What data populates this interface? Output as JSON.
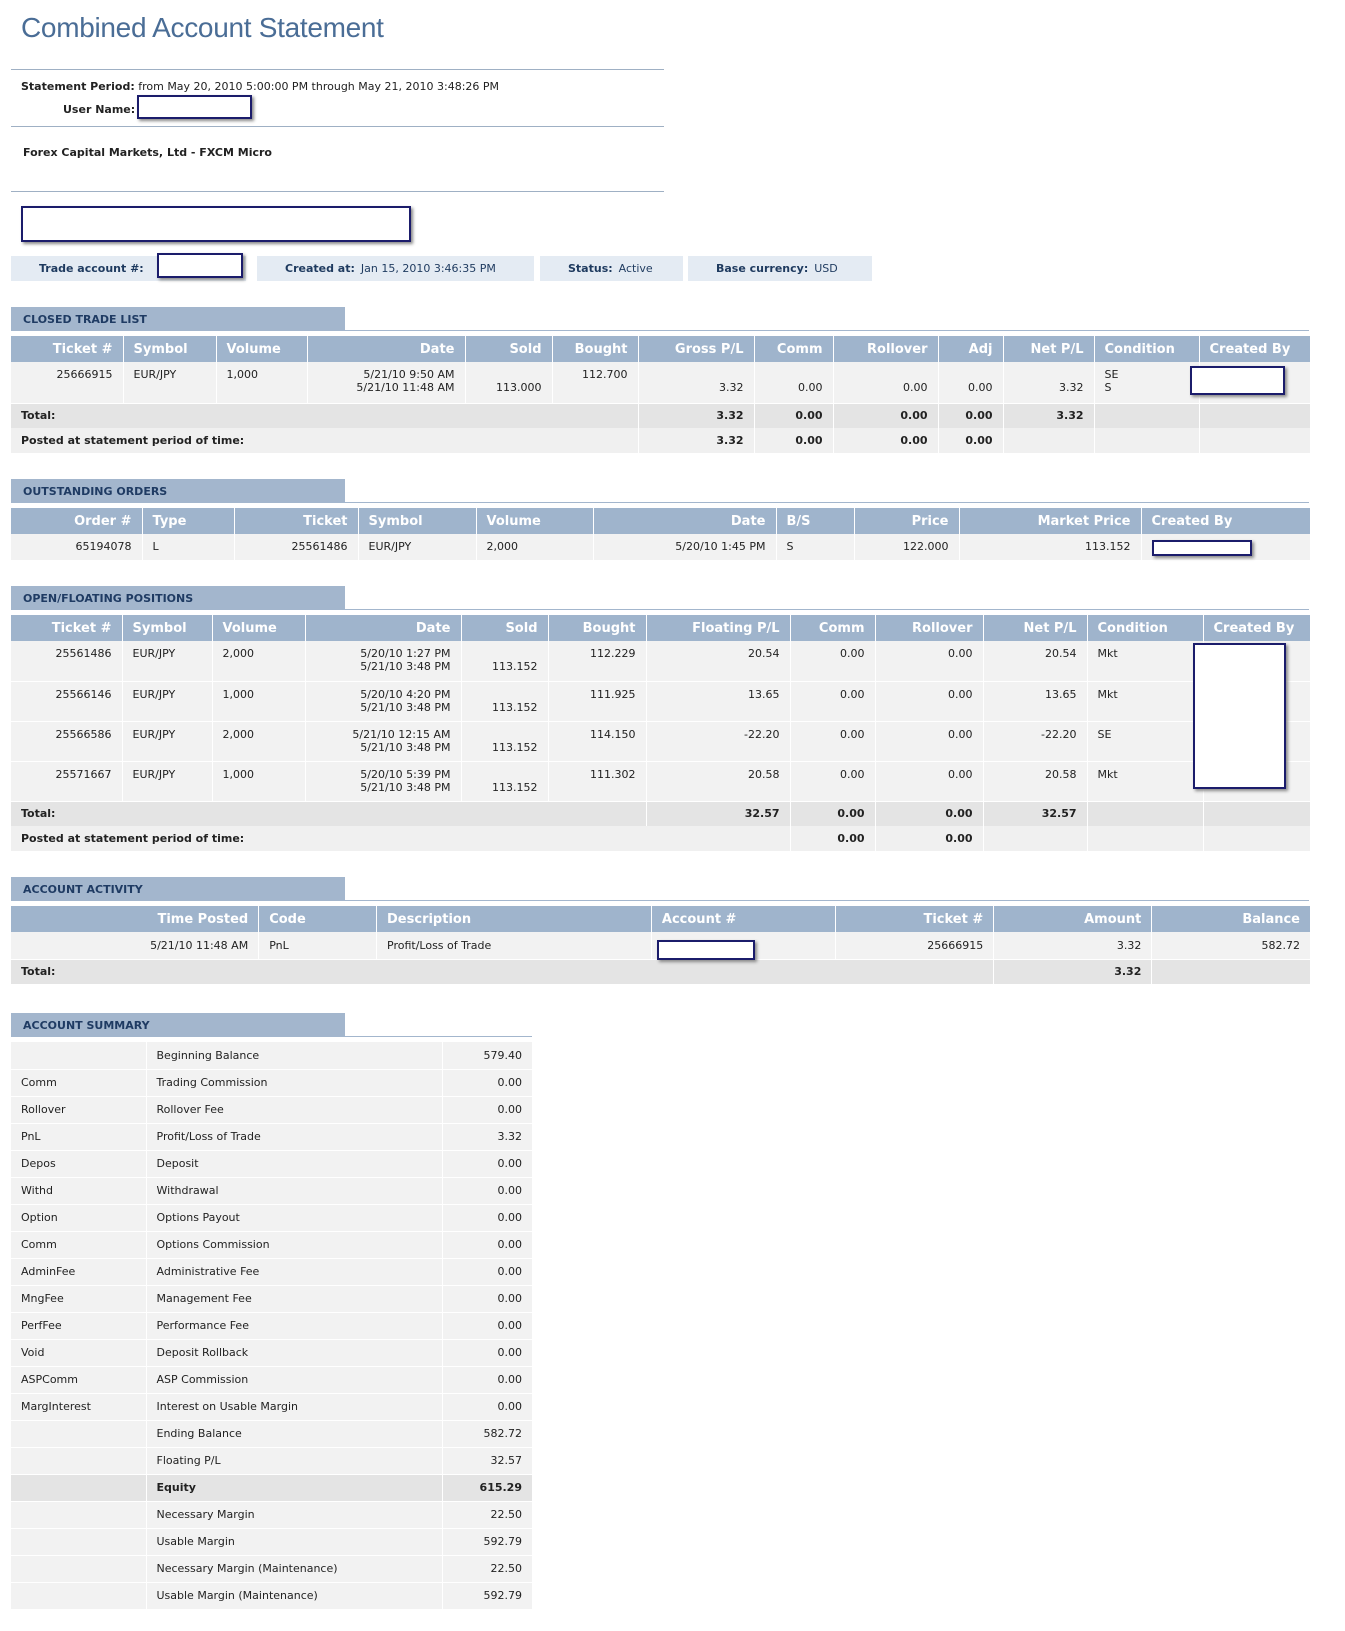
{
  "title": "Combined Account Statement",
  "statement": {
    "period_label": "Statement Period:",
    "period_value": "from May 20, 2010 5:00:00 PM through May 21, 2010 3:48:26 PM",
    "user_label": "User Name:",
    "company": "Forex Capital Markets, Ltd - FXCM Micro"
  },
  "infobar": {
    "account_label": "Trade account #:",
    "created_label": "Created at:",
    "created_value": "Jan 15, 2010 3:46:35 PM",
    "status_label": "Status:",
    "status_value": "Active",
    "currency_label": "Base currency:",
    "currency_value": "USD"
  },
  "closed": {
    "title": "CLOSED TRADE LIST",
    "headers": [
      "Ticket #",
      "Symbol",
      "Volume",
      "Date",
      "Sold",
      "Bought",
      "Gross P/L",
      "Comm",
      "Rollover",
      "Adj",
      "Net P/L",
      "Condition",
      "Created By"
    ],
    "row": {
      "ticket": "25666915",
      "symbol": "EUR/JPY",
      "volume": "1,000",
      "date1": "5/21/10 9:50 AM",
      "date2": "5/21/10 11:48 AM",
      "sold": "113.000",
      "bought": "112.700",
      "gross": "3.32",
      "comm": "0.00",
      "rollover": "0.00",
      "adj": "0.00",
      "net": "3.32",
      "cond1": "SE",
      "cond2": "S"
    },
    "total_label": "Total:",
    "total": {
      "gross": "3.32",
      "comm": "0.00",
      "rollover": "0.00",
      "adj": "0.00",
      "net": "3.32"
    },
    "posted_label": "Posted at statement period of time:",
    "posted": {
      "gross": "3.32",
      "comm": "0.00",
      "rollover": "0.00",
      "adj": "0.00"
    }
  },
  "orders": {
    "title": "OUTSTANDING ORDERS",
    "headers": [
      "Order #",
      "Type",
      "Ticket",
      "Symbol",
      "Volume",
      "Date",
      "B/S",
      "Price",
      "Market Price",
      "Created By"
    ],
    "row": {
      "order": "65194078",
      "type": "L",
      "ticket": "25561486",
      "symbol": "EUR/JPY",
      "volume": "2,000",
      "date": "5/20/10 1:45 PM",
      "bs": "S",
      "price": "122.000",
      "market": "113.152"
    }
  },
  "open": {
    "title": "OPEN/FLOATING POSITIONS",
    "headers": [
      "Ticket #",
      "Symbol",
      "Volume",
      "Date",
      "Sold",
      "Bought",
      "Floating P/L",
      "Comm",
      "Rollover",
      "Net P/L",
      "Condition",
      "Created By"
    ],
    "rows": [
      {
        "ticket": "25561486",
        "symbol": "EUR/JPY",
        "volume": "2,000",
        "date1": "5/20/10 1:27 PM",
        "date2": "5/21/10 3:48 PM",
        "sold": "113.152",
        "bought": "112.229",
        "floating": "20.54",
        "comm": "0.00",
        "rollover": "0.00",
        "net": "20.54",
        "cond": "Mkt"
      },
      {
        "ticket": "25566146",
        "symbol": "EUR/JPY",
        "volume": "1,000",
        "date1": "5/20/10 4:20 PM",
        "date2": "5/21/10 3:48 PM",
        "sold": "113.152",
        "bought": "111.925",
        "floating": "13.65",
        "comm": "0.00",
        "rollover": "0.00",
        "net": "13.65",
        "cond": "Mkt"
      },
      {
        "ticket": "25566586",
        "symbol": "EUR/JPY",
        "volume": "2,000",
        "date1": "5/21/10 12:15 AM",
        "date2": "5/21/10 3:48 PM",
        "sold": "113.152",
        "bought": "114.150",
        "floating": "-22.20",
        "comm": "0.00",
        "rollover": "0.00",
        "net": "-22.20",
        "cond": "SE"
      },
      {
        "ticket": "25571667",
        "symbol": "EUR/JPY",
        "volume": "1,000",
        "date1": "5/20/10 5:39 PM",
        "date2": "5/21/10 3:48 PM",
        "sold": "113.152",
        "bought": "111.302",
        "floating": "20.58",
        "comm": "0.00",
        "rollover": "0.00",
        "net": "20.58",
        "cond": "Mkt"
      }
    ],
    "total_label": "Total:",
    "total": {
      "floating": "32.57",
      "comm": "0.00",
      "rollover": "0.00",
      "net": "32.57"
    },
    "posted_label": "Posted at statement period of time:",
    "posted": {
      "comm": "0.00",
      "rollover": "0.00"
    }
  },
  "activity": {
    "title": "ACCOUNT ACTIVITY",
    "headers": [
      "Time Posted",
      "Code",
      "Description",
      "Account #",
      "Ticket #",
      "Amount",
      "Balance"
    ],
    "row": {
      "time": "5/21/10 11:48 AM",
      "code": "PnL",
      "desc": "Profit/Loss of Trade",
      "ticket": "25666915",
      "amount": "3.32",
      "balance": "582.72"
    },
    "total_label": "Total:",
    "total_amount": "3.32"
  },
  "summary": {
    "title": "ACCOUNT SUMMARY",
    "rows": [
      {
        "code": "",
        "desc": "Beginning Balance",
        "value": "579.40"
      },
      {
        "code": "Comm",
        "desc": "Trading Commission",
        "value": "0.00"
      },
      {
        "code": "Rollover",
        "desc": "Rollover Fee",
        "value": "0.00"
      },
      {
        "code": "PnL",
        "desc": "Profit/Loss of Trade",
        "value": "3.32"
      },
      {
        "code": "Depos",
        "desc": "Deposit",
        "value": "0.00"
      },
      {
        "code": "Withd",
        "desc": "Withdrawal",
        "value": "0.00"
      },
      {
        "code": "Option",
        "desc": "Options Payout",
        "value": "0.00"
      },
      {
        "code": "Comm",
        "desc": "Options Commission",
        "value": "0.00"
      },
      {
        "code": "AdminFee",
        "desc": "Administrative Fee",
        "value": "0.00"
      },
      {
        "code": "MngFee",
        "desc": "Management Fee",
        "value": "0.00"
      },
      {
        "code": "PerfFee",
        "desc": "Performance Fee",
        "value": "0.00"
      },
      {
        "code": "Void",
        "desc": "Deposit Rollback",
        "value": "0.00"
      },
      {
        "code": "ASPComm",
        "desc": "ASP Commission",
        "value": "0.00"
      },
      {
        "code": "MargInterest",
        "desc": "Interest on Usable Margin",
        "value": "0.00"
      },
      {
        "code": "",
        "desc": "Ending Balance",
        "value": "582.72"
      },
      {
        "code": "",
        "desc": "Floating P/L",
        "value": "32.57"
      },
      {
        "code": "",
        "desc": "Equity",
        "value": "615.29"
      },
      {
        "code": "",
        "desc": "Necessary Margin",
        "value": "22.50"
      },
      {
        "code": "",
        "desc": "Usable Margin",
        "value": "592.79"
      },
      {
        "code": "",
        "desc": "Necessary Margin (Maintenance)",
        "value": "22.50"
      },
      {
        "code": "",
        "desc": "Usable Margin (Maintenance)",
        "value": "592.79"
      }
    ]
  }
}
